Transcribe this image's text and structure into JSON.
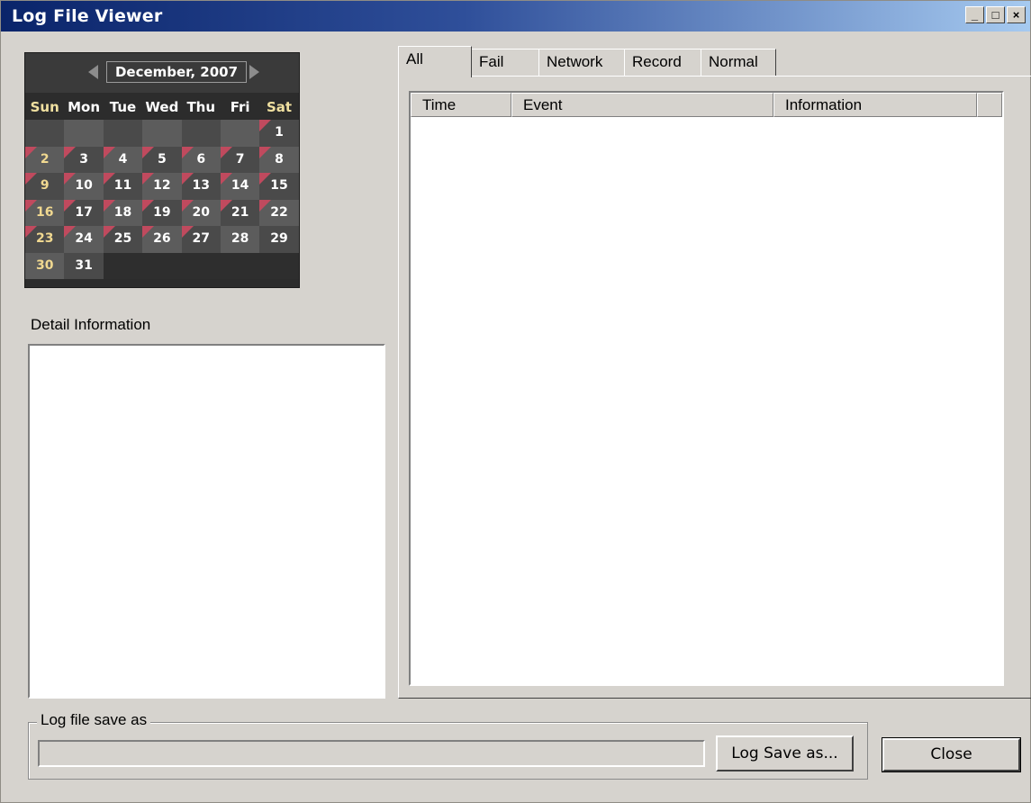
{
  "window": {
    "title": "Log File Viewer",
    "buttons": {
      "minimize": "_",
      "maximize": "□",
      "close": "×"
    }
  },
  "calendar": {
    "month_label": "December, 2007",
    "weekdays": [
      "Sun",
      "Mon",
      "Tue",
      "Wed",
      "Thu",
      "Fri",
      "Sat"
    ],
    "weeks": [
      [
        "",
        "",
        "",
        "",
        "",
        "",
        "1"
      ],
      [
        "2",
        "3",
        "4",
        "5",
        "6",
        "7",
        "8"
      ],
      [
        "9",
        "10",
        "11",
        "12",
        "13",
        "14",
        "15"
      ],
      [
        "16",
        "17",
        "18",
        "19",
        "20",
        "21",
        "22"
      ],
      [
        "23",
        "24",
        "25",
        "26",
        "27",
        "28",
        "29"
      ],
      [
        "30",
        "31",
        "",
        "",
        "",
        "",
        ""
      ]
    ],
    "marked_days": [
      "1",
      "2",
      "3",
      "4",
      "5",
      "6",
      "7",
      "8",
      "9",
      "10",
      "11",
      "12",
      "13",
      "14",
      "15",
      "16",
      "17",
      "18",
      "19",
      "20",
      "21",
      "22",
      "23",
      "24",
      "25",
      "26",
      "27"
    ],
    "mark_color": "#c04a5e"
  },
  "detail": {
    "label": "Detail Information"
  },
  "tabs": [
    {
      "label": "All",
      "active": true
    },
    {
      "label": "Fail",
      "active": false
    },
    {
      "label": "Network",
      "active": false
    },
    {
      "label": "Record",
      "active": false
    },
    {
      "label": "Normal",
      "active": false
    }
  ],
  "table": {
    "columns": [
      "Time",
      "Event",
      "Information"
    ]
  },
  "save": {
    "group_label": "Log file save as",
    "path_value": "",
    "save_button": "Log Save as...",
    "close_button": "Close"
  }
}
